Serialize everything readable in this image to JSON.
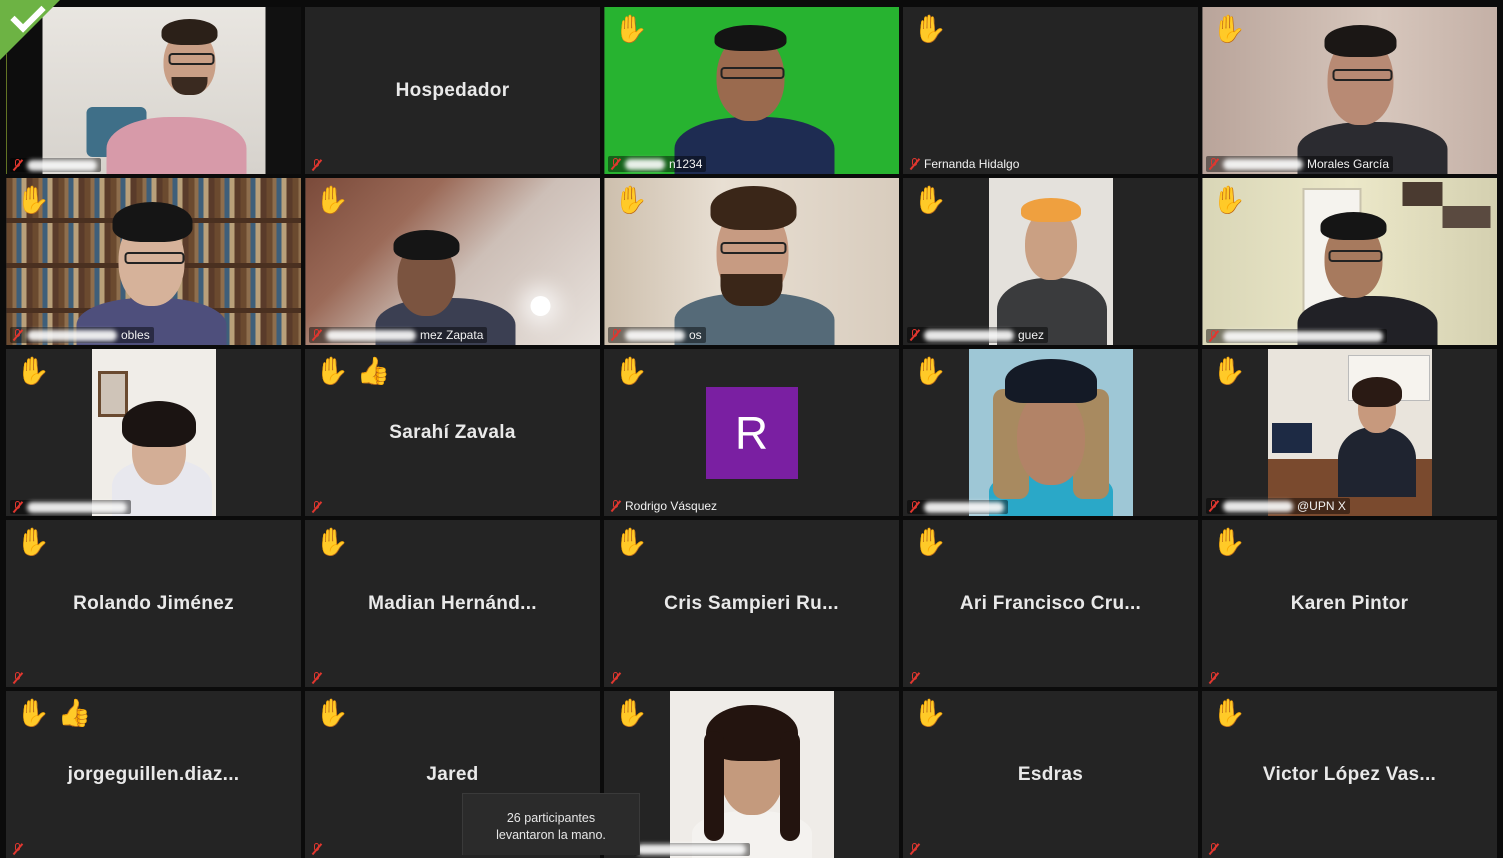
{
  "tiles": [
    {
      "id": "t1",
      "name": "Carlos Rda",
      "name_blurred": true,
      "reactions": [],
      "video": true,
      "active": true
    },
    {
      "id": "t2",
      "center_name": "Hospedador",
      "name": "",
      "reactions": [],
      "video": false
    },
    {
      "id": "t3",
      "name": "n1234",
      "name_blurred": true,
      "reactions": [
        "✋"
      ],
      "video": true
    },
    {
      "id": "t4",
      "name": "Fernanda Hidalgo",
      "reactions": [
        "✋"
      ],
      "video": false
    },
    {
      "id": "t5",
      "name": "Morales García",
      "name_blurred": true,
      "reactions": [
        "✋"
      ],
      "video": true
    },
    {
      "id": "t6",
      "name": "obles",
      "name_blurred": true,
      "reactions": [
        "✋"
      ],
      "video": true
    },
    {
      "id": "t7",
      "name": "mez Zapata",
      "name_blurred": true,
      "reactions": [
        "✋"
      ],
      "video": true
    },
    {
      "id": "t8",
      "name": "os",
      "name_blurred": true,
      "reactions": [
        "✋"
      ],
      "video": true
    },
    {
      "id": "t9",
      "name": "guez",
      "name_blurred": true,
      "reactions": [
        "✋"
      ],
      "video": true
    },
    {
      "id": "t10",
      "name": "",
      "name_blurred": true,
      "reactions": [
        "✋"
      ],
      "video": true
    },
    {
      "id": "t11",
      "name": "",
      "name_blurred": true,
      "reactions": [
        "✋"
      ],
      "video": true
    },
    {
      "id": "t12",
      "center_name": "Sarahí Zavala",
      "name": "",
      "reactions": [
        "✋",
        "👍"
      ],
      "video": false
    },
    {
      "id": "t13",
      "name": "Rodrigo Vásquez",
      "avatar_letter": "R",
      "reactions": [
        "✋"
      ],
      "video": false
    },
    {
      "id": "t14",
      "name": "",
      "name_blurred": true,
      "reactions": [
        "✋"
      ],
      "video": true
    },
    {
      "id": "t15",
      "name": "@UPN X",
      "name_blurred": true,
      "reactions": [
        "✋"
      ],
      "video": true
    },
    {
      "id": "t16",
      "center_name": "Rolando Jiménez",
      "name": "",
      "reactions": [
        "✋"
      ],
      "video": false
    },
    {
      "id": "t17",
      "center_name": "Madian Hernánd...",
      "name": "",
      "reactions": [
        "✋"
      ],
      "video": false
    },
    {
      "id": "t18",
      "center_name": "Cris Sampieri Ru...",
      "name": "",
      "reactions": [
        "✋"
      ],
      "video": false
    },
    {
      "id": "t19",
      "center_name": "Ari Francisco Cru...",
      "name": "",
      "reactions": [
        "✋"
      ],
      "video": false
    },
    {
      "id": "t20",
      "center_name": "Karen Pintor",
      "name": "",
      "reactions": [
        "✋"
      ],
      "video": false
    },
    {
      "id": "t21",
      "center_name": "jorgeguillen.diaz...",
      "name": "",
      "reactions": [
        "✋",
        "👍"
      ],
      "video": false
    },
    {
      "id": "t22",
      "center_name": "Jared",
      "name": "",
      "reactions": [
        "✋"
      ],
      "video": false
    },
    {
      "id": "t23",
      "name": "ira nez",
      "name_blurred": true,
      "reactions": [
        "✋"
      ],
      "video": true
    },
    {
      "id": "t24",
      "center_name": "Esdras",
      "name": "",
      "reactions": [
        "✋"
      ],
      "video": false
    },
    {
      "id": "t25",
      "center_name": "Victor López Vas...",
      "name": "",
      "reactions": [
        "✋"
      ],
      "video": false
    }
  ],
  "toast": {
    "line1": "26 participantes",
    "line2": "levantaron la mano."
  },
  "colors": {
    "active_border": "#b6dc3a",
    "mute_icon": "#e0372f",
    "avatar_bg": "#7a1fa2",
    "tile_bg": "#242424"
  },
  "icons": {
    "mute": "microphone-muted-icon",
    "hand": "raised-hand-icon",
    "thumbs": "thumbs-up-icon",
    "corner": "checkmark-badge-icon"
  }
}
